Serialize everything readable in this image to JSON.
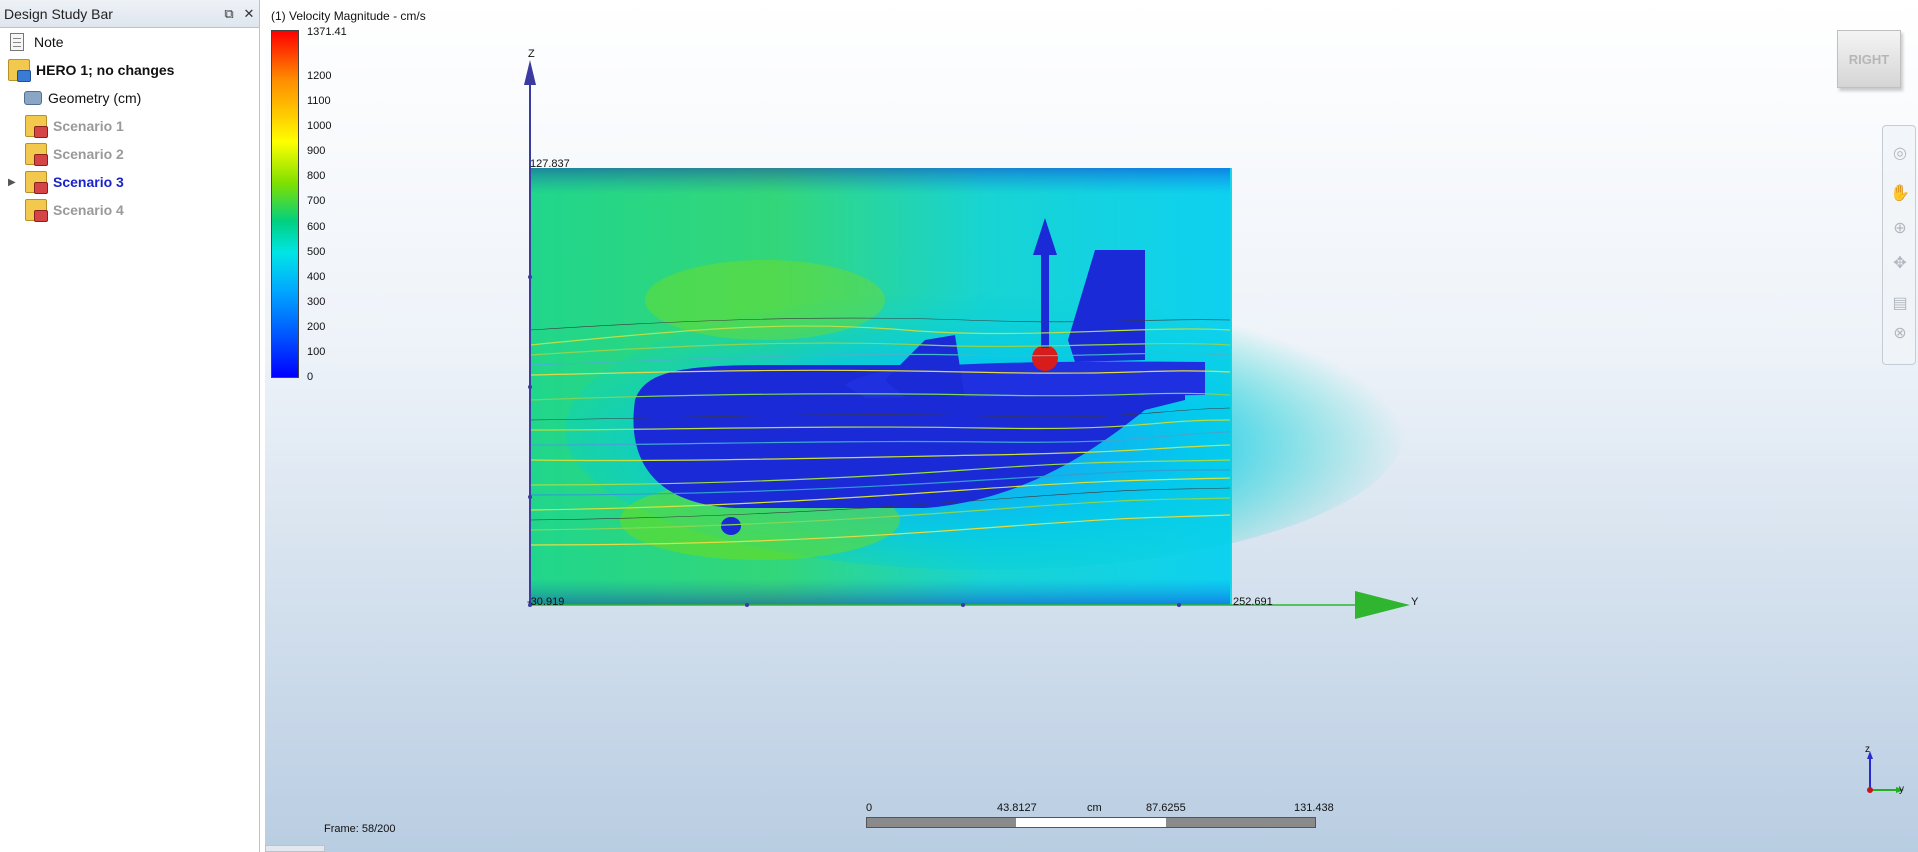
{
  "sidebar": {
    "title": "Design Study Bar",
    "controls": {
      "restore_icon": "restore-window-icon",
      "close_icon": "close-icon"
    },
    "items": [
      {
        "label": "Note",
        "icon": "note-icon",
        "style": "normal"
      },
      {
        "label": "HERO 1; no changes",
        "icon": "design-folder-icon",
        "style": "bold"
      },
      {
        "label": "Geometry (cm)",
        "icon": "geometry-icon",
        "style": "normal"
      },
      {
        "label": "Scenario 1",
        "icon": "scenario-folder-icon",
        "style": "dim"
      },
      {
        "label": "Scenario 2",
        "icon": "scenario-folder-icon",
        "style": "dim"
      },
      {
        "label": "Scenario 3",
        "icon": "scenario-folder-icon",
        "style": "active",
        "expandable": true
      },
      {
        "label": "Scenario 4",
        "icon": "scenario-folder-icon",
        "style": "dim"
      }
    ]
  },
  "viewport": {
    "title": "(1) Velocity Magnitude - cm/s",
    "legend": {
      "max_label": "1371.41",
      "ticks": [
        "1200",
        "1100",
        "1000",
        "900",
        "800",
        "700",
        "600",
        "500",
        "400",
        "300",
        "200",
        "100",
        "0"
      ],
      "colors": {
        "high": "#ff0000",
        "mid": "#00d080",
        "low": "#0000ff"
      }
    },
    "axes": {
      "z_label": "Z",
      "y_label": "Y",
      "z_top_value": "127.837",
      "origin_value": "-30.919",
      "y_end_value": "252.691"
    },
    "view_cube_label": "RIGHT",
    "frame_label": "Frame: 58/200",
    "scale": {
      "values": [
        "0",
        "43.8127",
        "87.6255",
        "131.438"
      ],
      "unit": "cm"
    },
    "triad": {
      "z": "z",
      "y": "y"
    },
    "nav_icons": [
      "orbit-icon",
      "pan-icon",
      "zoom-icon",
      "fit-icon",
      "display-icon",
      "close-view-icon"
    ],
    "colors": {
      "axis_z": "#3a3aa0",
      "axis_y": "#2fb52f",
      "body": "#1a2ad6"
    }
  }
}
